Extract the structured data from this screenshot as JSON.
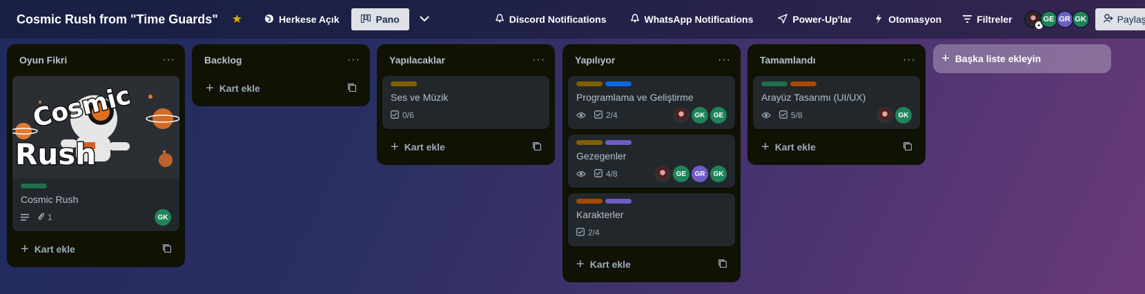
{
  "header": {
    "board_title": "Cosmic Rush from \"Time Guards\"",
    "visibility": "Herkese Açık",
    "view": "Pano",
    "discord": "Discord Notifications",
    "whatsapp": "WhatsApp Notifications",
    "powerups": "Power-Up'lar",
    "automation": "Otomasyon",
    "filters": "Filtreler",
    "members": [
      "GE",
      "GR",
      "GK"
    ],
    "share": "Paylaş"
  },
  "add_card_label": "Kart ekle",
  "add_list_label": "Başka liste ekleyin",
  "lists": [
    {
      "title": "Oyun Fikri",
      "cards": [
        {
          "cover_text": [
            "Cosmic",
            "Rush"
          ],
          "title": "Cosmic Rush",
          "labels": [
            "#216e4e"
          ],
          "attachments": "1",
          "members": [
            "GK"
          ]
        }
      ]
    },
    {
      "title": "Backlog",
      "cards": []
    },
    {
      "title": "Yapılacaklar",
      "cards": [
        {
          "title": "Ses ve Müzik",
          "labels": [
            "#7f5f01"
          ],
          "checklist": "0/6"
        }
      ]
    },
    {
      "title": "Yapılıyor",
      "cards": [
        {
          "title": "Programlama ve Geliştirme",
          "labels": [
            "#7f5f01",
            "#0c66e4"
          ],
          "checklist": "2/4",
          "members": [
            "GK",
            "GE"
          ]
        },
        {
          "title": "Gezegenler",
          "labels": [
            "#7f5f01",
            "#6e5dc6"
          ],
          "checklist": "4/8",
          "members": [
            "GE",
            "GR",
            "GK"
          ]
        },
        {
          "title": "Karakterler",
          "labels": [
            "#a54800",
            "#6e5dc6"
          ],
          "checklist": "2/4"
        }
      ]
    },
    {
      "title": "Tamamlandı",
      "cards": [
        {
          "title": "Arayüz Tasarımı (UI/UX)",
          "labels": [
            "#216e4e",
            "#a54800"
          ],
          "checklist": "5/8",
          "members": [
            "GK"
          ]
        }
      ]
    }
  ],
  "icons": {
    "globe": "globe-icon",
    "board": "board-icon",
    "bell": "bell-icon",
    "rocket": "rocket-icon",
    "bolt": "bolt-icon",
    "filter": "filter-icon",
    "eye": "eye-icon",
    "checklist": "checklist-icon",
    "paperclip": "paperclip-icon",
    "description": "description-icon"
  }
}
